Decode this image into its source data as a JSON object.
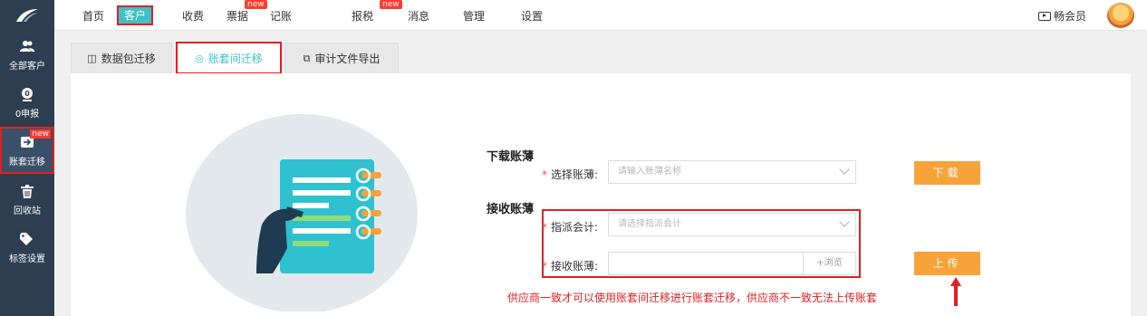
{
  "nav": {
    "items": [
      {
        "label": "首页",
        "badge": ""
      },
      {
        "label": "客户",
        "badge": "",
        "active": true
      },
      {
        "label": "收费",
        "badge": ""
      },
      {
        "label": "票据",
        "badge": "new"
      },
      {
        "label": "记账",
        "badge": ""
      },
      {
        "label": "报税",
        "badge": "new"
      },
      {
        "label": "消息",
        "badge": ""
      },
      {
        "label": "管理",
        "badge": ""
      },
      {
        "label": "设置",
        "badge": ""
      }
    ],
    "member_label": "畅会员"
  },
  "sidebar": {
    "items": [
      {
        "label": "全部客户",
        "icon": "users-icon"
      },
      {
        "label": "0申报",
        "icon": "zero-declare-icon"
      },
      {
        "label": "账套迁移",
        "icon": "migrate-icon",
        "badge": "new",
        "active": true
      },
      {
        "label": "回收站",
        "icon": "trash-icon"
      },
      {
        "label": "标签设置",
        "icon": "tag-icon"
      }
    ]
  },
  "tabs": [
    {
      "label": "数据包迁移",
      "icon": "package-icon"
    },
    {
      "label": "账套间迁移",
      "icon": "transfer-icon",
      "active": true
    },
    {
      "label": "审计文件导出",
      "icon": "export-icon"
    }
  ],
  "download": {
    "title": "下载账薄",
    "select_label": "选择账薄:",
    "select_placeholder": "请输入账薄名称",
    "button": "下载"
  },
  "receive": {
    "title": "接收账薄",
    "assign_label": "指派会计:",
    "assign_placeholder": "请选择指派会计",
    "book_label": "接收账薄:",
    "browse": "+浏览",
    "button": "上传"
  },
  "note": "供应商一致才可以使用账套间迁移进行账套迁移，供应商不一致无法上传账套",
  "colors": {
    "accent": "#3ec1c9",
    "sidebar": "#2d3e50",
    "button": "#f7a33a",
    "highlight": "#e02020"
  }
}
